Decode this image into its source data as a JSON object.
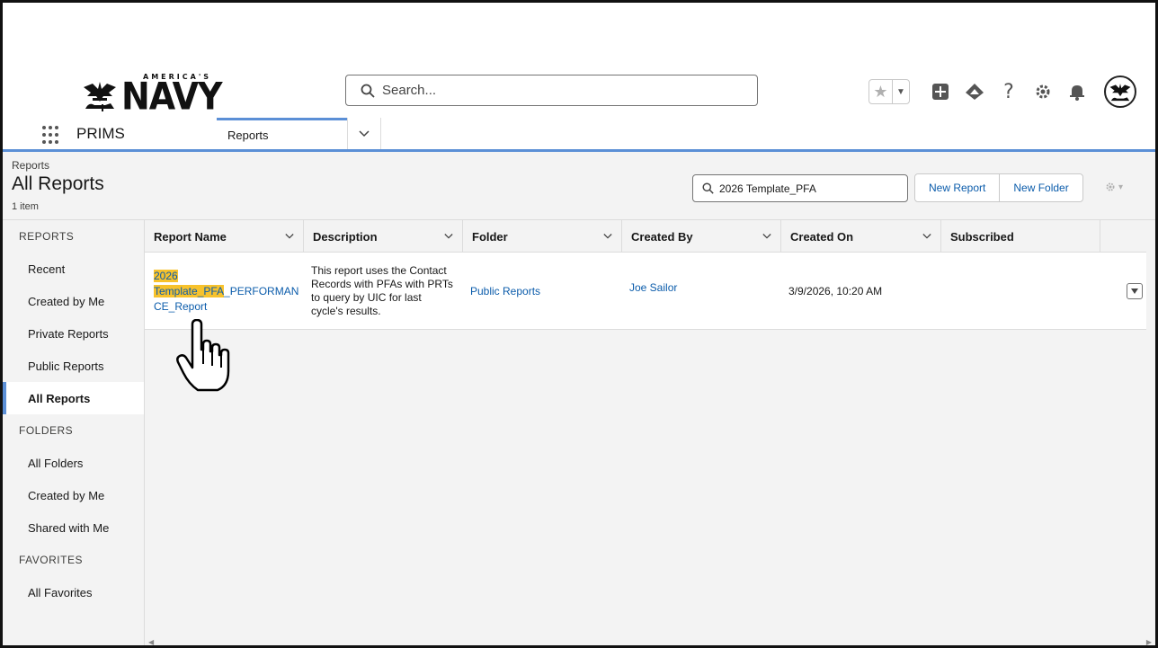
{
  "header": {
    "logo_small_text": "AMERICA'S",
    "logo_text": "NAVY",
    "search_placeholder": "Search...",
    "icons": [
      "star-icon",
      "favorites-dropdown-icon",
      "add-icon",
      "trailhead-icon",
      "help-icon",
      "setup-gear-icon",
      "notifications-bell-icon",
      "user-avatar"
    ]
  },
  "app_nav": {
    "app_name": "PRIMS",
    "active_tab": "Reports"
  },
  "list_header": {
    "breadcrumb": "Reports",
    "title": "All Reports",
    "count": "1 item",
    "filter_value": "2026 Template_PFA",
    "new_report_label": "New Report",
    "new_folder_label": "New Folder"
  },
  "sidebar": {
    "sections": [
      {
        "title": "REPORTS",
        "items": [
          "Recent",
          "Created by Me",
          "Private Reports",
          "Public Reports",
          "All Reports"
        ]
      },
      {
        "title": "FOLDERS",
        "items": [
          "All Folders",
          "Created by Me",
          "Shared with Me"
        ]
      },
      {
        "title": "FAVORITES",
        "items": [
          "All Favorites"
        ]
      }
    ],
    "active_item": "All Reports"
  },
  "table": {
    "columns": [
      "Report Name",
      "Description",
      "Folder",
      "Created By",
      "Created On",
      "Subscribed"
    ],
    "rows": [
      {
        "name_hl_1": "2026",
        "name_hl_2": "Template_PFA",
        "name_rest_1": "_PERFORMAN",
        "name_rest_2": "CE_Report",
        "description": "This report uses the Contact Records with PFAs with PRTs to query by UIC for last cycle's results.",
        "folder": "Public Reports",
        "created_by": "Joe Sailor",
        "created_on": "3/9/2026, 10:20 AM",
        "subscribed": ""
      }
    ]
  },
  "colors": {
    "brand_blue": "#5b8fd6",
    "link_blue": "#0b5cab",
    "highlight": "#f7c22c",
    "panel_gray": "#f3f3f3"
  }
}
